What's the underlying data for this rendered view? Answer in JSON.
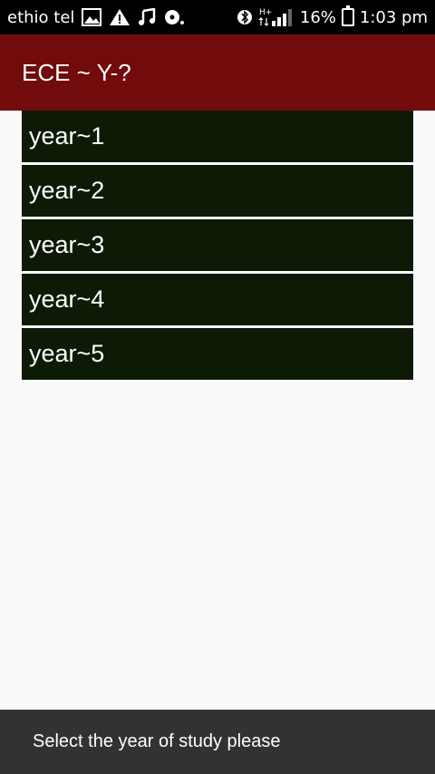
{
  "status_bar": {
    "carrier": "ethio tel",
    "battery_percent": "16%",
    "time": "1:03 pm",
    "network_label": "H+",
    "icons": [
      "image-icon",
      "warning-icon",
      "music-icon",
      "disc-icon",
      "bluetooth-icon",
      "signal-icon",
      "battery-icon"
    ]
  },
  "app_bar": {
    "title": "ECE ~ Y-?",
    "color": "#720b0b"
  },
  "list": {
    "item_color": "#0d1a05",
    "items": [
      {
        "label": "year~1"
      },
      {
        "label": "year~2"
      },
      {
        "label": "year~3"
      },
      {
        "label": "year~4"
      },
      {
        "label": "year~5"
      }
    ]
  },
  "snackbar": {
    "message": "Select the year of study please"
  }
}
